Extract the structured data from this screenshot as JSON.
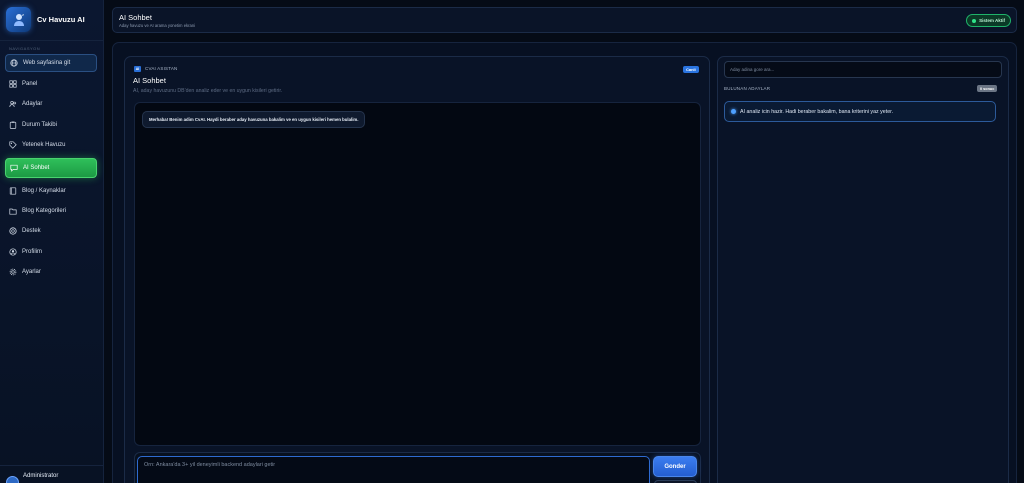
{
  "app": {
    "brand": "Cv Havuzu AI"
  },
  "sidebar": {
    "section_heading": "NAVIGASYON",
    "items": [
      {
        "label": "Web sayfasina git",
        "icon": "globe-icon"
      },
      {
        "label": "Panel",
        "icon": "grid-icon"
      },
      {
        "label": "Adaylar",
        "icon": "users-icon"
      },
      {
        "label": "Durum Takibi",
        "icon": "clipboard-icon"
      },
      {
        "label": "Yetenek Havuzu",
        "icon": "tag-icon"
      },
      {
        "label": "AI Sohbet",
        "icon": "chat-icon",
        "active": true
      },
      {
        "label": "Blog / Kaynaklar",
        "icon": "book-icon"
      },
      {
        "label": "Blog Kategorileri",
        "icon": "folder-icon"
      },
      {
        "label": "Destek",
        "icon": "lifebuoy-icon"
      },
      {
        "label": "Profilim",
        "icon": "user-icon"
      },
      {
        "label": "Ayarlar",
        "icon": "gear-icon"
      }
    ],
    "user": {
      "name": "Administrator"
    }
  },
  "header": {
    "title": "AI Sohbet",
    "subtitle": "Aday havuzu ve AI arama yonetim ekrani",
    "status": "Sistem Aktif"
  },
  "chat": {
    "ai_badge": "AI",
    "eyebrow": "CVAI ASISTAN",
    "title": "AI Sohbet",
    "description": "AI, aday havuzunu DB'den analiz eder ve en uygun kisileri getirir.",
    "live_badge": "Canli",
    "messages": [
      {
        "from": "assistant",
        "text": "Merhaba! Benim adim CvAI. Haydi beraber aday havuzuna bakalim ve en uygun kisileri hemen bulalim."
      }
    ],
    "input_placeholder": "Orn: Ankara'da 3+ yil deneyimli backend adaylari getir",
    "send_label": "Gonder"
  },
  "candidates": {
    "search_placeholder": "Aday adina gore ara...",
    "section_label": "BULUNAN ADAYLAR",
    "count_badge": "0 sonuc",
    "info": "AI analiz icin hazir. Hadi beraber bakalim, bana kriterini yaz yeter."
  },
  "colors": {
    "accent_blue": "#2a74e0",
    "active_green": "#2fbf5a",
    "background": "#050b16"
  }
}
